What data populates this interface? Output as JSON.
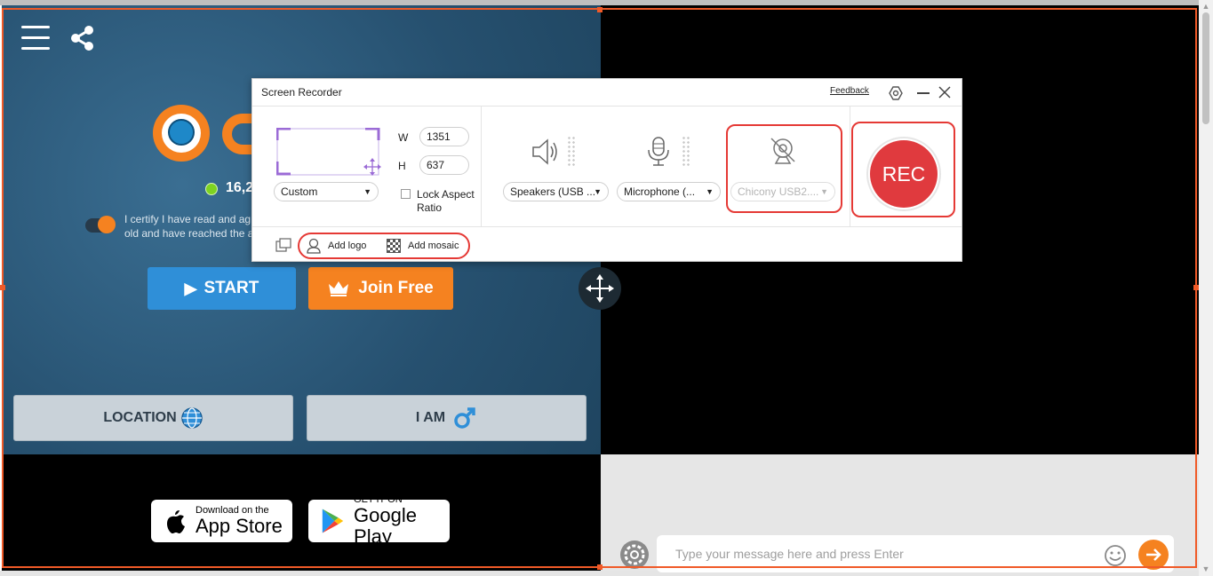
{
  "site": {
    "user_count": "16,2",
    "certify_line1": "I certify I have read and ag",
    "certify_line2": "old and have reached the a",
    "start_label": "START",
    "join_label": "Join Free",
    "location_label": "LOCATION",
    "iam_label": "I AM",
    "appstore_small": "Download on the",
    "appstore_big": "App Store",
    "googleplay_small": "GET IT ON",
    "googleplay_big": "Google Play",
    "chat_placeholder": "Type your message here and press Enter"
  },
  "recorder": {
    "title": "Screen Recorder",
    "feedback_label": "Feedback",
    "width_label": "W",
    "width_value": "1351",
    "height_label": "H",
    "height_value": "637",
    "preset_value": "Custom",
    "lock_aspect_line1": "Lock Aspect",
    "lock_aspect_line2": "Ratio",
    "speakers_value": "Speakers (USB ...",
    "microphone_value": "Microphone (...",
    "camera_value": "Chicony USB2....",
    "rec_label": "REC",
    "add_logo_label": "Add logo",
    "add_mosaic_label": "Add mosaic"
  },
  "colors": {
    "accent_orange": "#f05a28",
    "rec_red": "#e03a3e",
    "start_blue": "#2f8fd8",
    "join_orange": "#f58220",
    "recorder_purple": "#9b6bd6"
  }
}
